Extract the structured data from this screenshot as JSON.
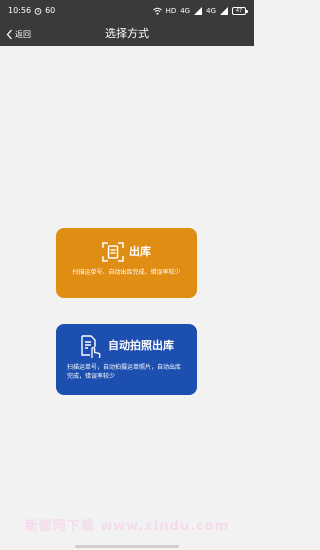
{
  "status_bar": {
    "time": "10:56",
    "speed": "60",
    "network": "HD",
    "signal_1": "4G",
    "signal_2": "4G",
    "battery": "47"
  },
  "nav": {
    "back_label": "返回",
    "title": "选择方式"
  },
  "options": [
    {
      "title": "出库",
      "description": "扫描运单号、自动出库完成，错误率较少",
      "color": "#e08d14",
      "icon": "scan-frame-icon"
    },
    {
      "title": "自动拍照出库",
      "description": "扫描运单号，自动拍摄运单照片，自动出库完成，错误率较少",
      "color": "#1d4fb0",
      "icon": "document-tap-icon"
    }
  ],
  "watermark": "新都网下载 www.xindu.com"
}
